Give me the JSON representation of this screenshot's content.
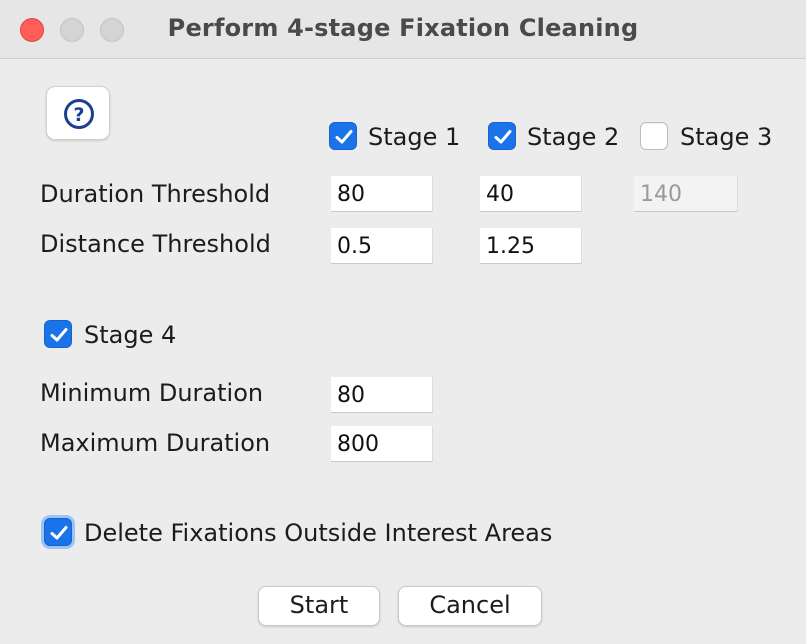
{
  "window": {
    "title": "Perform 4-stage Fixation Cleaning"
  },
  "help": {
    "icon": "question-circle-icon"
  },
  "stages": [
    {
      "label": "Stage 1",
      "checked": true
    },
    {
      "label": "Stage 2",
      "checked": true
    },
    {
      "label": "Stage 3",
      "checked": false
    }
  ],
  "rows": {
    "duration_label": "Duration Threshold",
    "distance_label": "Distance Threshold",
    "duration_values": [
      "80",
      "40",
      "140"
    ],
    "distance_values": [
      "0.5",
      "1.25"
    ]
  },
  "stage4": {
    "label": "Stage 4",
    "checked": true,
    "min_label": "Minimum Duration",
    "min_value": "80",
    "max_label": "Maximum Duration",
    "max_value": "800"
  },
  "delete_option": {
    "label": "Delete Fixations Outside Interest Areas",
    "checked": true
  },
  "buttons": {
    "start": "Start",
    "cancel": "Cancel"
  },
  "colors": {
    "accent": "#1a73e8",
    "close": "#ff5f57"
  }
}
